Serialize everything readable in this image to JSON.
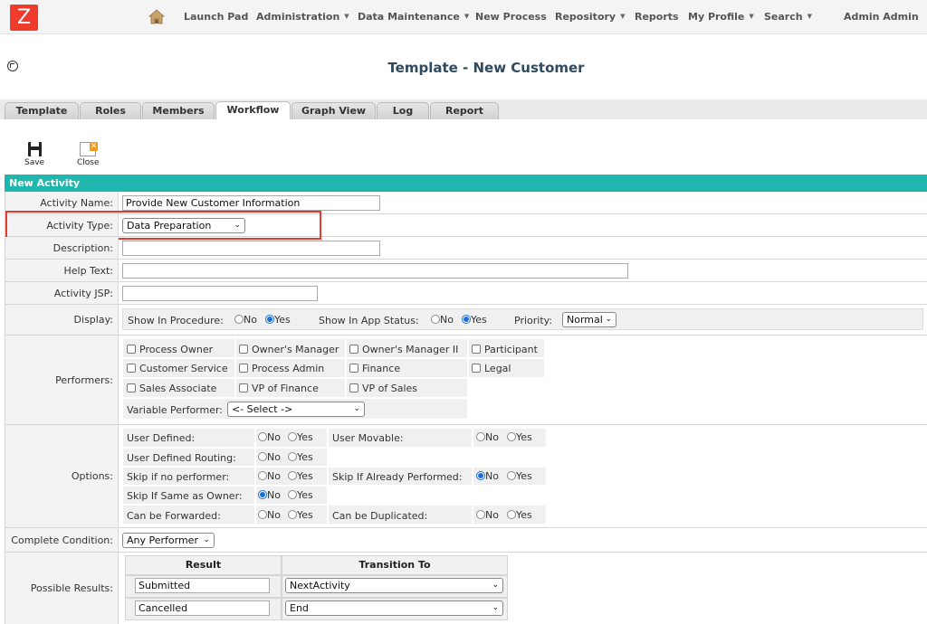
{
  "nav": {
    "logo": "Z",
    "items": [
      "Launch Pad",
      "Administration",
      "Data Maintenance",
      "New Process",
      "Repository",
      "Reports",
      "My Profile",
      "Search",
      "Admin Admin"
    ]
  },
  "page": {
    "title": "Template - New Customer"
  },
  "tabs": [
    "Template",
    "Roles",
    "Members",
    "Workflow",
    "Graph View",
    "Log",
    "Report"
  ],
  "toolbar": {
    "save": "Save",
    "close": "Close"
  },
  "section": {
    "title": "New Activity"
  },
  "form": {
    "activity_name_label": "Activity Name:",
    "activity_name_value": "Provide New Customer Information",
    "activity_type_label": "Activity Type:",
    "activity_type_value": "Data Preparation",
    "description_label": "Description:",
    "help_text_label": "Help Text:",
    "activity_jsp_label": "Activity JSP:",
    "display_label": "Display:",
    "display": {
      "show_in_procedure": "Show In Procedure:",
      "show_in_app_status": "Show In App Status:",
      "priority": "Priority:",
      "priority_value": "Normal",
      "no": "No",
      "yes": "Yes"
    },
    "performers_label": "Performers:",
    "performers": [
      "Process Owner",
      "Owner's Manager",
      "Owner's Manager II",
      "Participant",
      "Customer Service",
      "Process Admin",
      "Finance",
      "Legal",
      "Sales Associate",
      "VP of Finance",
      "VP of Sales"
    ],
    "variable_performer_label": "Variable Performer:",
    "variable_performer_value": "<- Select ->",
    "options_label": "Options:",
    "options": {
      "user_defined": "User Defined:",
      "user_movable": "User Movable:",
      "user_defined_routing": "User Defined Routing:",
      "skip_if_no_performer": "Skip if no performer:",
      "skip_if_already_performed": "Skip If Already Performed:",
      "skip_if_same_as_owner": "Skip If Same as Owner:",
      "can_be_forwarded": "Can be Forwarded:",
      "can_be_duplicated": "Can be Duplicated:"
    },
    "complete_condition_label": "Complete Condition:",
    "complete_condition_value": "Any Performer",
    "possible_results_label": "Possible Results:",
    "results": {
      "header_result": "Result",
      "header_transition": "Transition To",
      "rows": [
        {
          "result": "Submitted",
          "transition": "NextActivity"
        },
        {
          "result": "Cancelled",
          "transition": "End"
        }
      ]
    }
  },
  "colors": {
    "accent": "#1fb6ae",
    "logo": "#ee3b2b",
    "highlight": "#e23c2c",
    "radio": "#1a6fd6"
  }
}
